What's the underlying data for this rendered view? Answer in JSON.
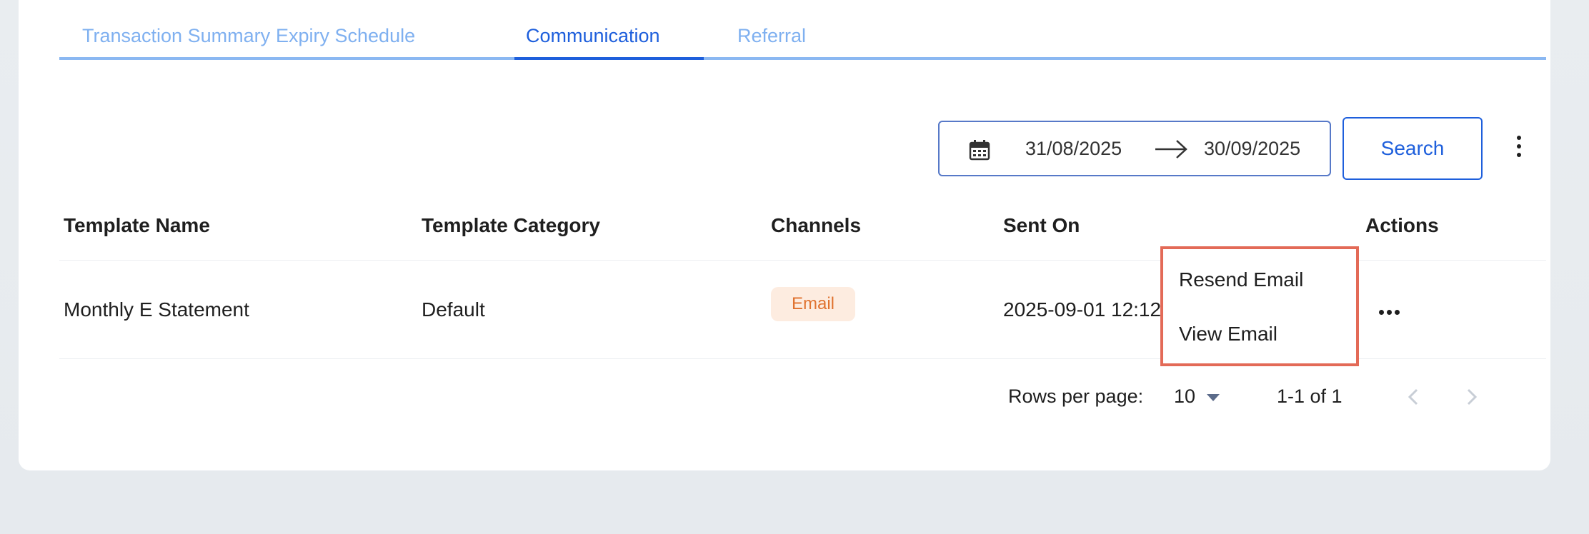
{
  "tabs": [
    {
      "label": "Transaction Summary"
    },
    {
      "label": "Expiry Schedule"
    },
    {
      "label": "Communication"
    },
    {
      "label": "Referral"
    }
  ],
  "active_tab": "Communication",
  "filter": {
    "start_date": "31/08/2025",
    "end_date": "30/09/2025",
    "search_label": "Search",
    "calendar_icon": "calendar-icon",
    "arrow_icon": "arrow-right-icon"
  },
  "table": {
    "headers": [
      "Template Name",
      "Template Category",
      "Channels",
      "Sent On",
      "Actions"
    ],
    "rows": [
      {
        "template_name": "Monthly E Statement",
        "template_category": "Default",
        "channel": "Email",
        "sent_on": "2025-09-01 12:12"
      }
    ]
  },
  "row_menu": {
    "items": [
      "Resend Email",
      "View Email"
    ]
  },
  "pagination": {
    "rows_per_page_label": "Rows per page:",
    "rows_per_page_value": "10",
    "range": "1-1 of 1"
  },
  "colors": {
    "accent": "#1e5fdc",
    "tab_inactive": "#7fb0f0",
    "badge_bg": "#fdece0",
    "badge_text": "#e0722f",
    "highlight_border": "#e36a57"
  }
}
